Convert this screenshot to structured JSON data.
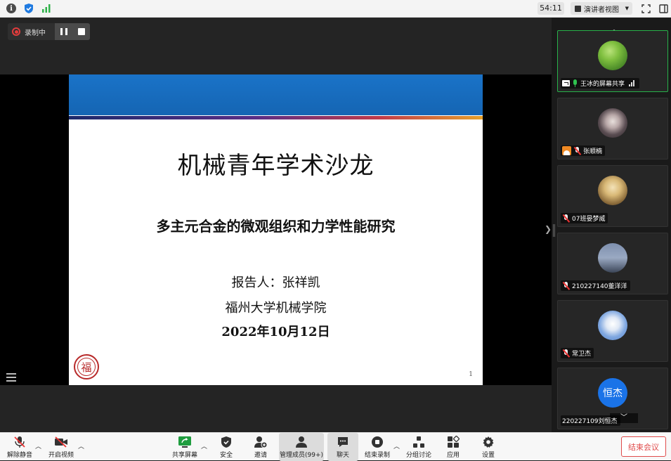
{
  "topbar": {
    "timer": "54:11",
    "view_label": "演讲者视图"
  },
  "recording": {
    "label": "录制中"
  },
  "slide": {
    "title": "机械青年学术沙龙",
    "subtitle": "多主元合金的微观组织和力学性能研究",
    "reporter": "报告人：张祥凯",
    "institution": "福州大学机械学院",
    "date": "2022年10月12日",
    "page_number": "1",
    "logo_char": "福"
  },
  "participants": [
    {
      "name": "王冰的屏幕共享",
      "mic": "on",
      "sharing": true,
      "active": true
    },
    {
      "name": "张顺楠",
      "mic": "muted"
    },
    {
      "name": "07班晏梦威",
      "mic": "muted"
    },
    {
      "name": "210227140董洋洋",
      "mic": "muted"
    },
    {
      "name": "常卫杰",
      "mic": "muted"
    },
    {
      "name": "220227109刘恒杰",
      "mic": "none",
      "avatar_text": "恒杰"
    }
  ],
  "toolbar": {
    "unmute": "解除静音",
    "start_video": "开启视频",
    "share_screen": "共享屏幕",
    "security": "安全",
    "invite": "邀请",
    "manage_members": "管理成员(99+)",
    "chat": "聊天",
    "stop_recording": "结束录制",
    "breakout": "分组讨论",
    "apps": "应用",
    "settings": "设置",
    "end_meeting": "结束会议"
  },
  "colors": {
    "active_border": "#28b24a",
    "record_red": "#e23c3c",
    "end_red": "#e04b4b",
    "slide_blue": "#1a73c8"
  }
}
